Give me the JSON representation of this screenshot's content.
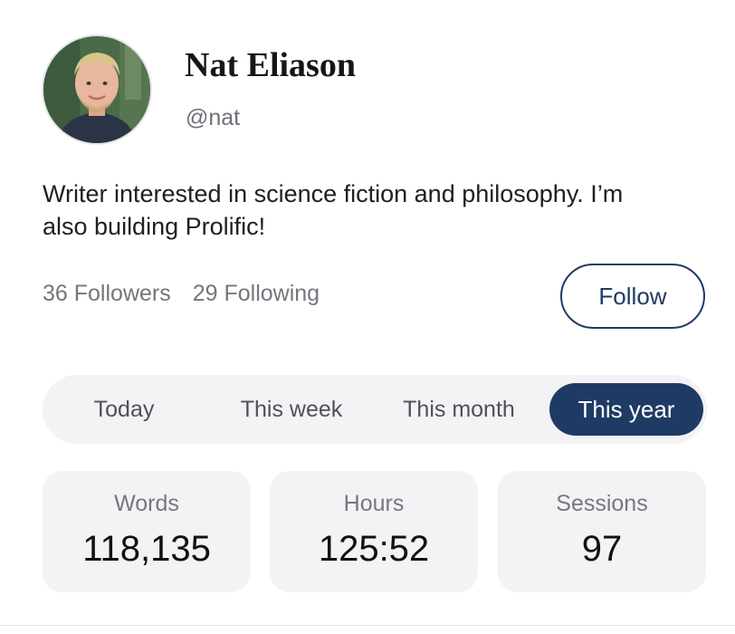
{
  "profile": {
    "name": "Nat Eliason",
    "handle": "@nat",
    "bio": "Writer interested in science fiction and philosophy. I’m also building Prolific!",
    "followers_label": "36 Followers",
    "following_label": "29 Following",
    "follow_label": "Follow",
    "avatar_icon": "profile-photo"
  },
  "range_tabs": {
    "items": [
      "Today",
      "This week",
      "This month",
      "This year"
    ],
    "selected": "This year"
  },
  "stats": [
    {
      "label": "Words",
      "value": "118,135"
    },
    {
      "label": "Hours",
      "value": "125:52"
    },
    {
      "label": "Sessions",
      "value": "97"
    }
  ],
  "colors": {
    "accent": "#1f3a64",
    "card_fill": "#f3f3f5",
    "muted_text": "#75757d"
  }
}
